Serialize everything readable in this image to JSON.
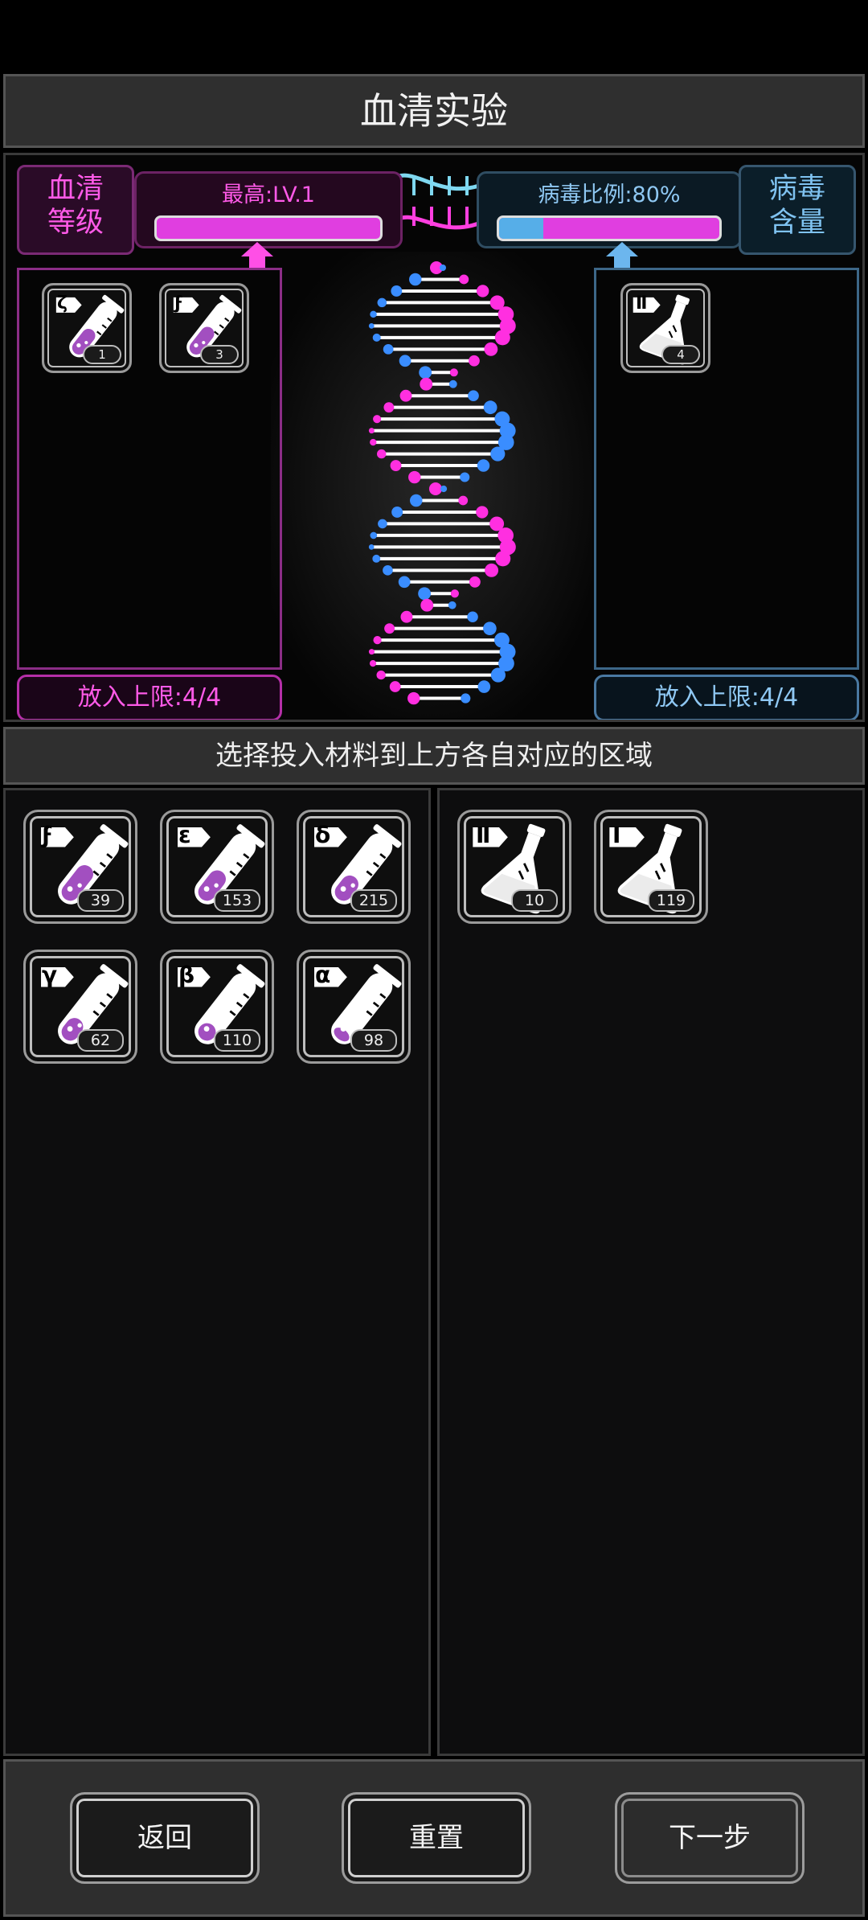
{
  "title": "血清实验",
  "serum": {
    "tag": [
      "血清",
      "等级"
    ],
    "meter_label": "最高:LV.1",
    "limit_label": "放入上限:4/4",
    "slots": [
      {
        "greek": "ζ",
        "count": "1",
        "fill": 0.6
      },
      {
        "greek": "ϝ",
        "count": "3",
        "fill": 0.65
      }
    ]
  },
  "virus": {
    "tag": [
      "病毒",
      "含量"
    ],
    "meter_label": "病毒比例:80%",
    "ratio": 0.2,
    "limit_label": "放入上限:4/4",
    "slots": [
      {
        "numeral": "Ⅱ",
        "count": "4"
      }
    ]
  },
  "instruction": "选择投入材料到上方各自对应的区域",
  "inventory_serums": [
    {
      "greek": "ϝ",
      "count": "39",
      "fill": 0.65
    },
    {
      "greek": "ε",
      "count": "153",
      "fill": 0.55
    },
    {
      "greek": "δ",
      "count": "215",
      "fill": 0.45
    },
    {
      "greek": "γ",
      "count": "62",
      "fill": 0.4
    },
    {
      "greek": "β",
      "count": "110",
      "fill": 0.3
    },
    {
      "greek": "α",
      "count": "98",
      "fill": 0.2
    }
  ],
  "inventory_viruses": [
    {
      "numeral": "Ⅱ",
      "count": "10"
    },
    {
      "numeral": "Ⅰ",
      "count": "119"
    }
  ],
  "buttons": {
    "back": "返回",
    "reset": "重置",
    "next": "下一步"
  },
  "colors": {
    "serum_accent": "#ff5ae8",
    "virus_accent": "#56aee8",
    "serum_liquid": "#a24fc0"
  },
  "icons": [
    "test-tube-icon",
    "flask-icon",
    "arrow-up-icon",
    "dna-helix-icon"
  ]
}
